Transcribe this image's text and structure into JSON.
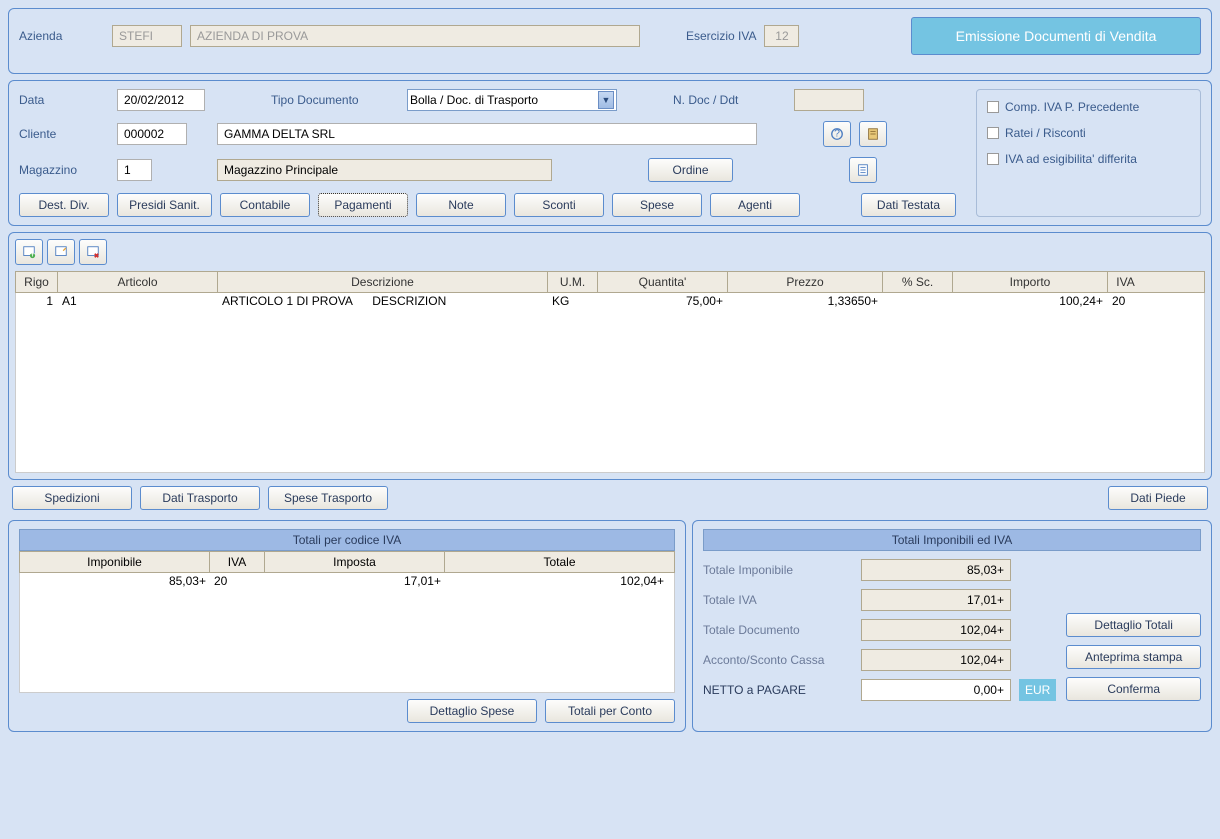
{
  "header": {
    "azienda_label": "Azienda",
    "azienda_code": "STEFI",
    "azienda_name": "AZIENDA DI PROVA",
    "esercizio_label": "Esercizio IVA",
    "esercizio_value": "12",
    "title": "Emissione Documenti di Vendita"
  },
  "form": {
    "data_label": "Data",
    "data_value": "20/02/2012",
    "tipo_doc_label": "Tipo Documento",
    "tipo_doc_value": "Bolla / Doc. di Trasporto",
    "ndoc_label": "N. Doc / Ddt",
    "ndoc_value": "",
    "cliente_label": "Cliente",
    "cliente_code": "000002",
    "cliente_name": "GAMMA DELTA SRL",
    "magazzino_label": "Magazzino",
    "magazzino_code": "1",
    "magazzino_name": "Magazzino Principale",
    "ordine_btn": "Ordine",
    "checkbox1": "Comp. IVA P. Precedente",
    "checkbox2": "Ratei / Risconti",
    "checkbox3": "IVA ad esigibilita' differita"
  },
  "tabs": {
    "dest_div": "Dest. Div.",
    "presidi": "Presidi Sanit.",
    "contabile": "Contabile",
    "pagamenti": "Pagamenti",
    "note": "Note",
    "sconti": "Sconti",
    "spese": "Spese",
    "agenti": "Agenti",
    "dati_testata": "Dati Testata"
  },
  "grid": {
    "headers": {
      "rigo": "Rigo",
      "articolo": "Articolo",
      "descrizione": "Descrizione",
      "um": "U.M.",
      "quantita": "Quantita'",
      "prezzo": "Prezzo",
      "sconto": "% Sc.",
      "importo": "Importo",
      "iva": "IVA"
    },
    "rows": [
      {
        "rigo": "1",
        "articolo": "A1",
        "descrizione": "ARTICOLO 1 DI PROVA      DESCRIZION",
        "um": "KG",
        "quantita": "75,00+",
        "prezzo": "1,33650+",
        "sconto": "",
        "importo": "100,24+",
        "iva": "20"
      }
    ]
  },
  "footer_buttons": {
    "spedizioni": "Spedizioni",
    "dati_trasporto": "Dati Trasporto",
    "spese_trasporto": "Spese Trasporto",
    "dati_piede": "Dati Piede"
  },
  "iva_section": {
    "title": "Totali per codice IVA",
    "headers": {
      "imponibile": "Imponibile",
      "iva": "IVA",
      "imposta": "Imposta",
      "totale": "Totale"
    },
    "rows": [
      {
        "imponibile": "85,03+",
        "iva": "20",
        "imposta": "17,01+",
        "totale": "102,04+"
      }
    ],
    "dettaglio_spese_btn": "Dettaglio Spese",
    "totali_conto_btn": "Totali per Conto"
  },
  "totals_section": {
    "title": "Totali Imponibili ed IVA",
    "totale_imponibile_label": "Totale Imponibile",
    "totale_imponibile_value": "85,03+",
    "totale_iva_label": "Totale IVA",
    "totale_iva_value": "17,01+",
    "totale_documento_label": "Totale Documento",
    "totale_documento_value": "102,04+",
    "acconto_label": "Acconto/Sconto Cassa",
    "acconto_value": "102,04+",
    "netto_label": "NETTO a PAGARE",
    "netto_value": "0,00+",
    "eur": "EUR",
    "dettaglio_totali_btn": "Dettaglio Totali",
    "anteprima_btn": "Anteprima stampa",
    "conferma_btn": "Conferma"
  }
}
